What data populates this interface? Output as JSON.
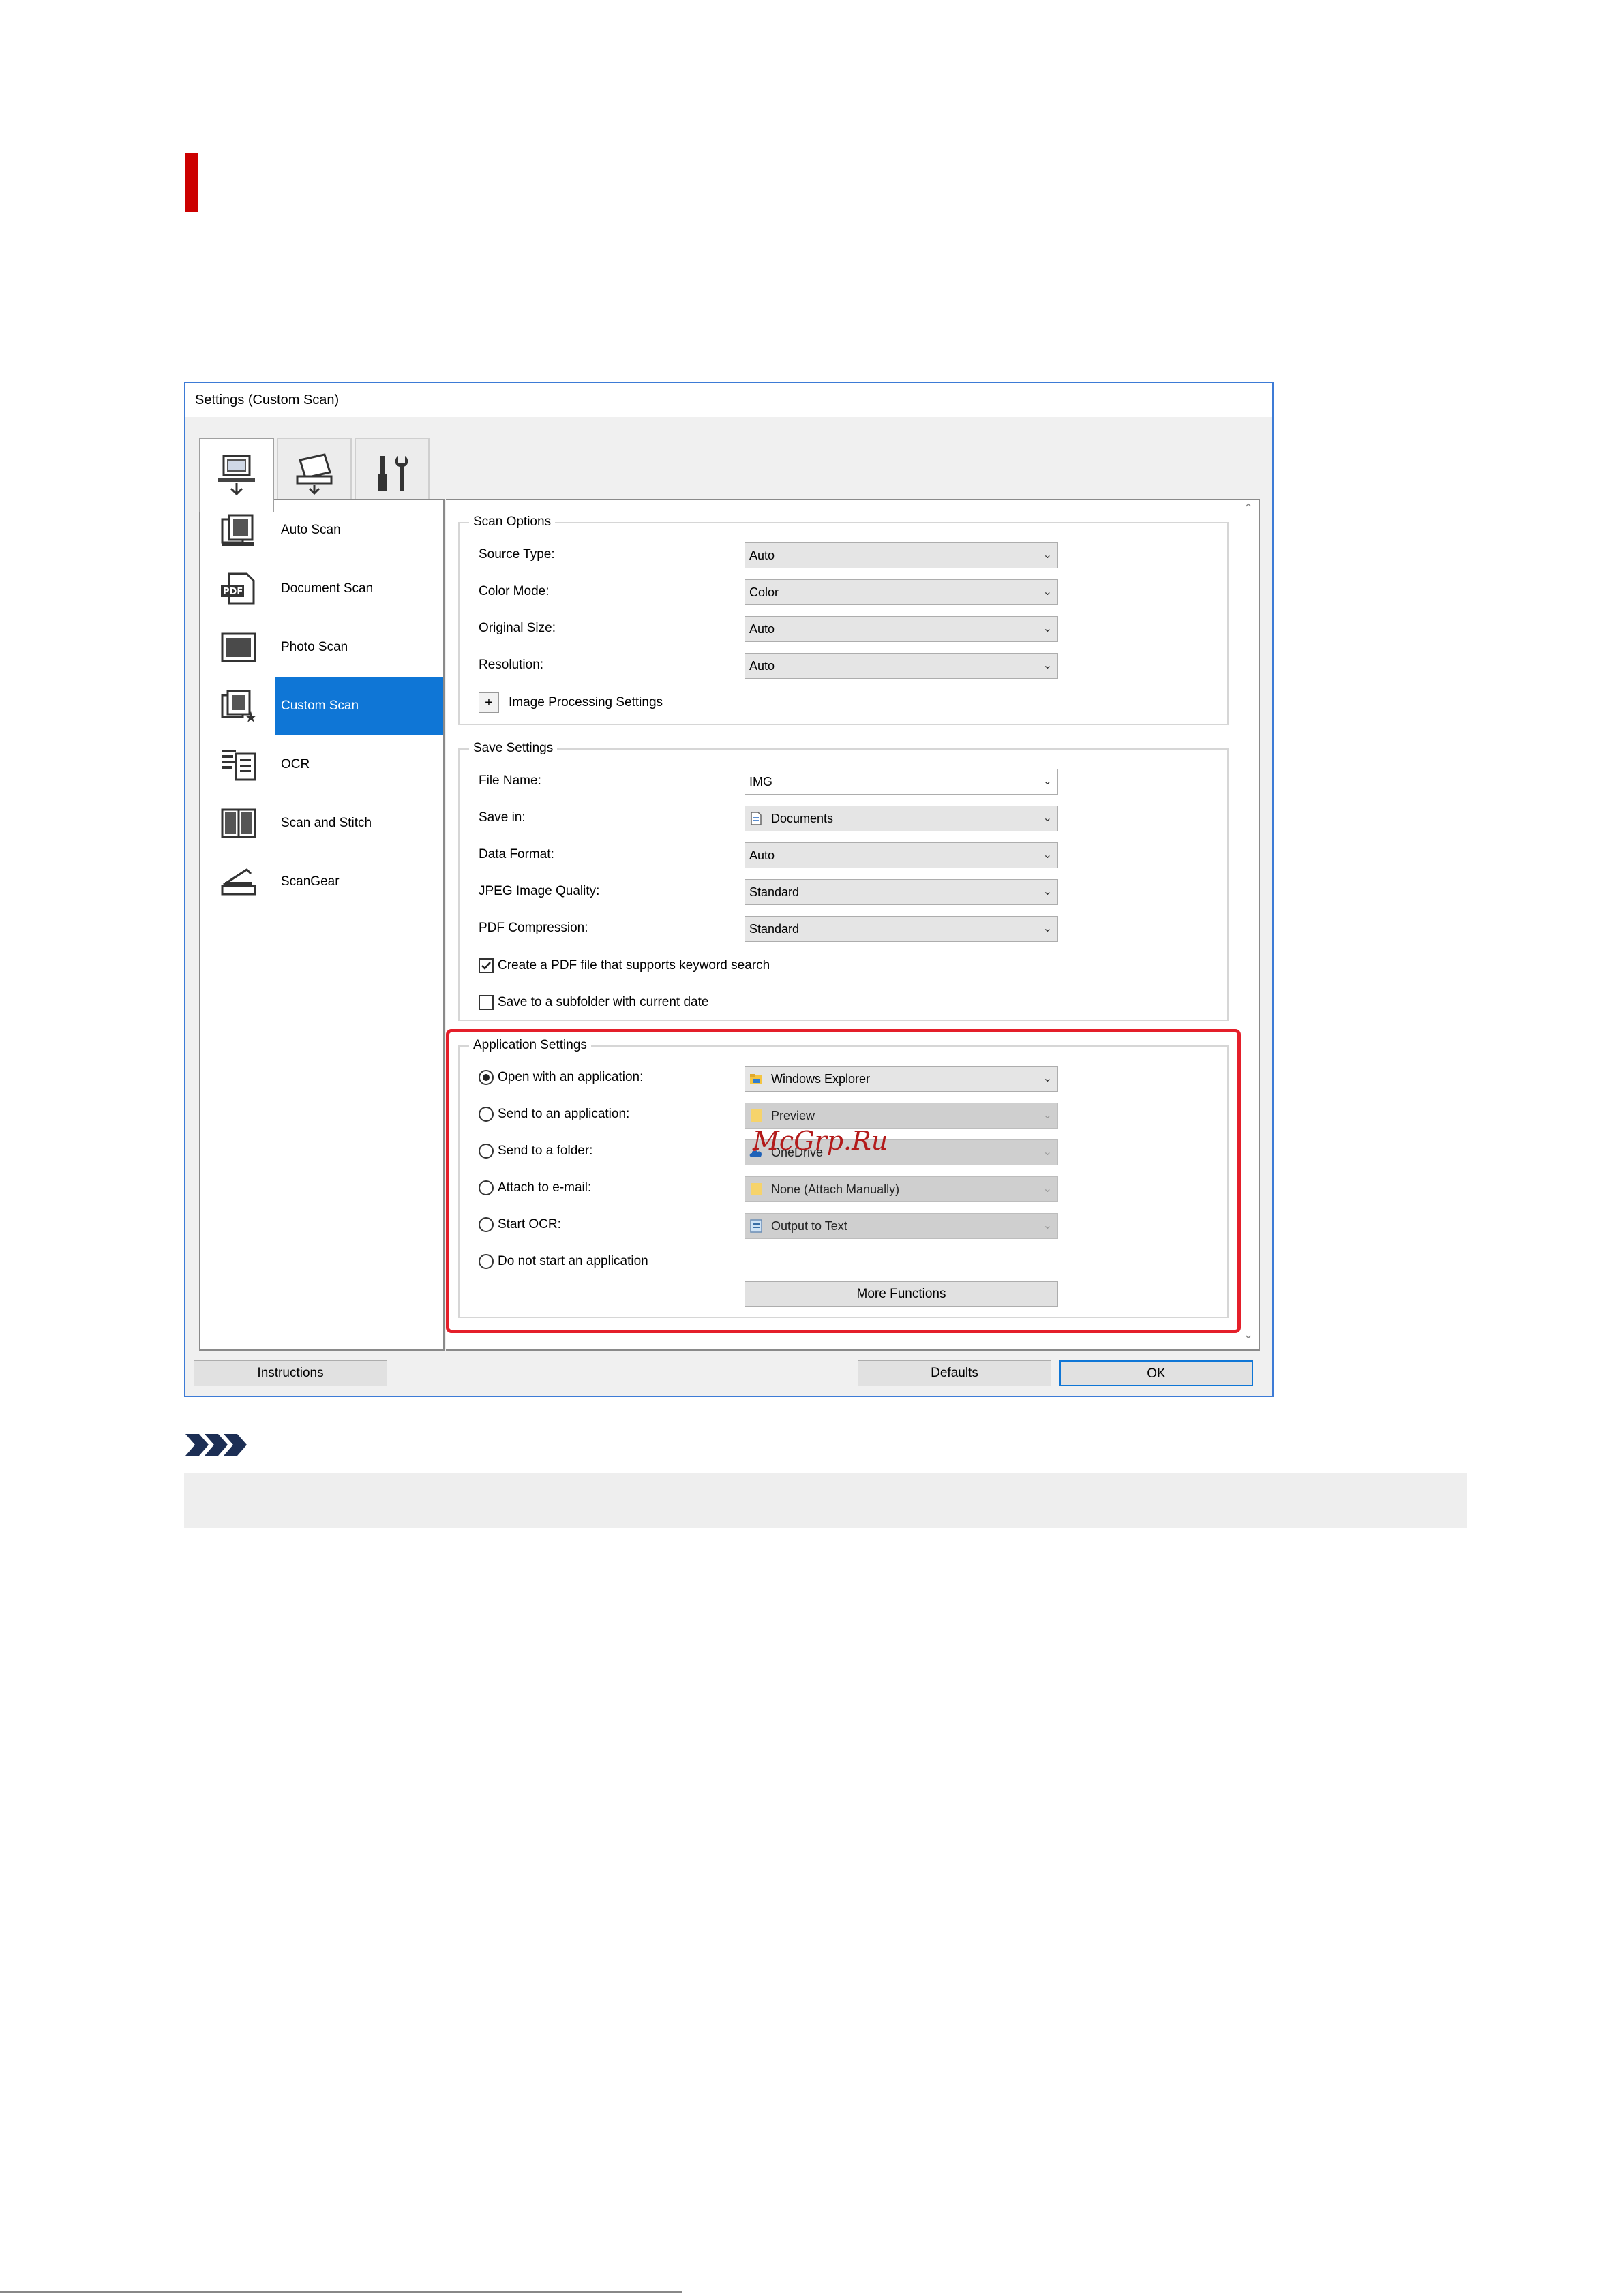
{
  "dialog": {
    "title": "Settings (Custom Scan)",
    "mode_tabs": [
      {
        "icon": "scan-from-computer-icon"
      },
      {
        "icon": "scan-from-panel-icon"
      },
      {
        "icon": "general-settings-icon"
      }
    ]
  },
  "sidebar": {
    "items": [
      {
        "label": "Auto Scan",
        "icon": "auto-scan-icon"
      },
      {
        "label": "Document Scan",
        "icon": "document-scan-icon"
      },
      {
        "label": "Photo Scan",
        "icon": "photo-scan-icon"
      },
      {
        "label": "Custom Scan",
        "icon": "custom-scan-icon",
        "selected": true
      },
      {
        "label": "OCR",
        "icon": "ocr-icon"
      },
      {
        "label": "Scan and Stitch",
        "icon": "scan-and-stitch-icon"
      },
      {
        "label": "ScanGear",
        "icon": "scangear-icon"
      }
    ]
  },
  "scan_options": {
    "title": "Scan Options",
    "source_type": {
      "label": "Source Type:",
      "value": "Auto"
    },
    "color_mode": {
      "label": "Color Mode:",
      "value": "Color"
    },
    "original_size": {
      "label": "Original Size:",
      "value": "Auto"
    },
    "resolution": {
      "label": "Resolution:",
      "value": "Auto"
    },
    "image_processing": {
      "label": "Image Processing Settings",
      "expand_symbol": "+"
    }
  },
  "save_settings": {
    "title": "Save Settings",
    "file_name": {
      "label": "File Name:",
      "value": "IMG"
    },
    "save_in": {
      "label": "Save in:",
      "value": "Documents"
    },
    "data_format": {
      "label": "Data Format:",
      "value": "Auto"
    },
    "jpeg_quality": {
      "label": "JPEG Image Quality:",
      "value": "Standard"
    },
    "pdf_compression": {
      "label": "PDF Compression:",
      "value": "Standard"
    },
    "keyword_pdf": {
      "label": "Create a PDF file that supports keyword search",
      "checked": true
    },
    "subfolder": {
      "label": "Save to a subfolder with current date",
      "checked": false
    }
  },
  "application_settings": {
    "title": "Application Settings",
    "open_app": {
      "label": "Open with an application:",
      "value": "Windows Explorer",
      "selected": true
    },
    "send_app": {
      "label": "Send to an application:",
      "value": "Preview"
    },
    "send_folder": {
      "label": "Send to a folder:",
      "value": "OneDrive"
    },
    "attach_email": {
      "label": "Attach to e-mail:",
      "value": "None (Attach Manually)"
    },
    "start_ocr": {
      "label": "Start OCR:",
      "value": "Output to Text"
    },
    "no_app": {
      "label": "Do not start an application"
    },
    "more_functions": "More Functions"
  },
  "footer": {
    "instructions": "Instructions",
    "defaults": "Defaults",
    "ok": "OK"
  },
  "watermark": "McGrp.Ru",
  "colors": {
    "highlight": "#e41f2a",
    "selection": "#0f76d6",
    "heading_bar": "#cc0000"
  }
}
